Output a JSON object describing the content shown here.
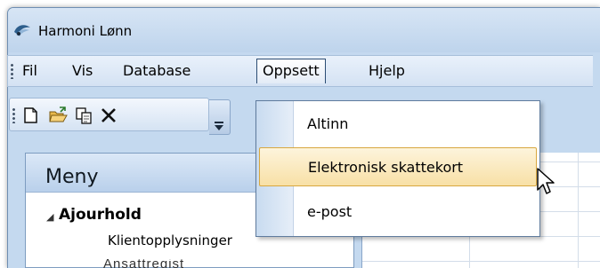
{
  "window": {
    "title": "Harmoni Lønn"
  },
  "menubar": {
    "items": [
      {
        "label": "Fil"
      },
      {
        "label": "Vis"
      },
      {
        "label": "Database"
      },
      {
        "label": "Oppsett"
      },
      {
        "label": "Hjelp"
      }
    ],
    "active": "Oppsett"
  },
  "toolbar": {
    "buttons": [
      "new-document-icon",
      "open-folder-icon",
      "copy-icon",
      "delete-icon"
    ]
  },
  "dropdown": {
    "items": [
      {
        "label": "Altinn"
      },
      {
        "label": "Elektronisk skattekort"
      },
      {
        "label": "e-post"
      }
    ],
    "highlighted": "Elektronisk skattekort"
  },
  "sidepanel": {
    "title": "Meny",
    "group": "Ajourhold",
    "child": "Klientopplysninger"
  },
  "colors": {
    "window_frame": "#c4d9ef",
    "highlight_fill": "#f8e0a6",
    "highlight_border": "#d8a73f"
  }
}
